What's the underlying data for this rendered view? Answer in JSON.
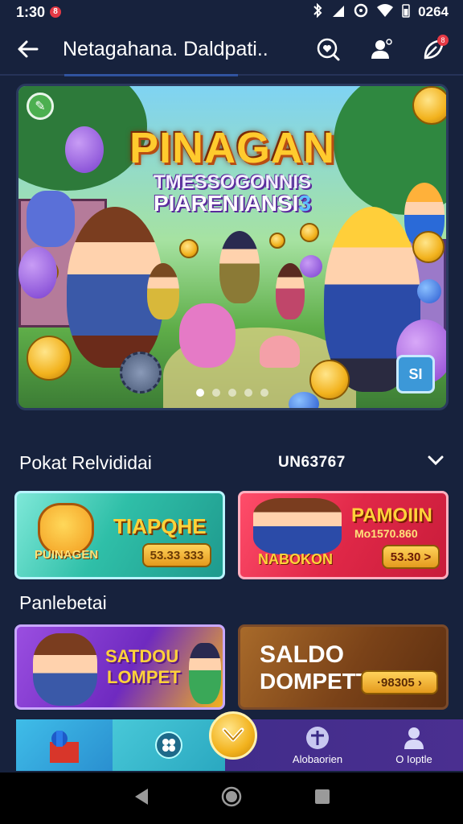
{
  "status_bar": {
    "time": "1:30",
    "notification_count": "8",
    "battery_text": "0264"
  },
  "app_bar": {
    "title": "Netagahana. Daldpati..",
    "message_badge": "8"
  },
  "hero": {
    "title": "PINAGAN",
    "subtitle_line1": "TMESSOGONNIS",
    "subtitle_line2": "PIARENIANSI",
    "subtitle_suffix": "3",
    "corner_button": "SI",
    "slides": 5,
    "active_slide": 1
  },
  "section1": {
    "label": "Pokat Relvididai",
    "code": "UN63767"
  },
  "cards_row1": [
    {
      "title": "TIAPQHE",
      "caption": "PUINAGEN",
      "pill": "53.33 333",
      "theme": "teal"
    },
    {
      "title": "PAMOIIN",
      "subtitle": "Mo1570.860",
      "caption": "NABOKON",
      "pill": "53.30 >",
      "theme": "red"
    }
  ],
  "section2": {
    "label": "Panlebetai"
  },
  "cards_row2": [
    {
      "title_line1": "SATDOU",
      "title_line2": "LOMPET",
      "theme": "purple"
    },
    {
      "title_line1": "SALDO",
      "title_line2": "DOMPETT",
      "pill": "·98305 ›",
      "theme": "brown"
    }
  ],
  "bottom_nav": {
    "items": [
      {
        "label": "",
        "icon": "home-game-icon"
      },
      {
        "label": "",
        "icon": "clover-icon"
      },
      {
        "label": "",
        "icon": "coin-fab-icon"
      },
      {
        "label": "Alobaorien",
        "icon": "activity-icon"
      },
      {
        "label": "O Ioptle",
        "icon": "profile-icon"
      }
    ]
  },
  "colors": {
    "background": "#17223d",
    "accent_gold": "#f2b21d",
    "nav_purple": "#3a2a86",
    "badge_red": "#e53945"
  }
}
